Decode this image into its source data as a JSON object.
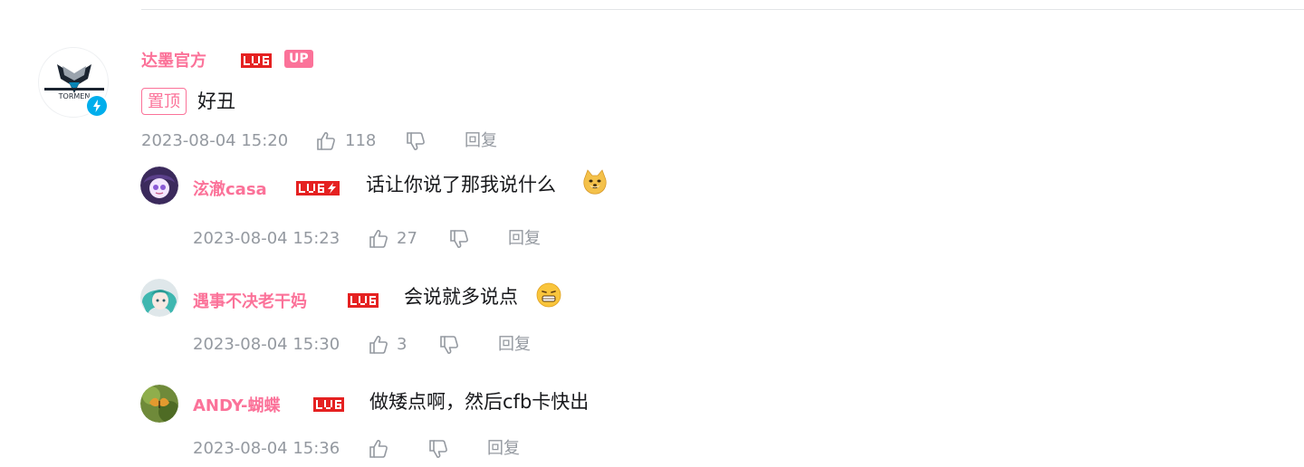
{
  "root": {
    "username": "达墨官方",
    "level": "LV6",
    "up_badge": "UP",
    "pin_label": "置顶",
    "content": "好丑",
    "time": "2023-08-04 15:20",
    "likes": "118",
    "reply_label": "回复"
  },
  "replies": [
    {
      "username": "泫澈casa",
      "level": "LV6",
      "content": "话让你说了那我说什么",
      "emoji": "doge-emoji",
      "time": "2023-08-04 15:23",
      "likes": "27",
      "reply_label": "回复"
    },
    {
      "username": "遇事不决老干妈",
      "level": "LV6",
      "content": "会说就多说点",
      "emoji": "grin-emoji",
      "time": "2023-08-04 15:30",
      "likes": "3",
      "reply_label": "回复"
    },
    {
      "username": "ANDY-蝴蝶",
      "level": "LV6",
      "content": "做矮点啊，然后cfb卡快出",
      "time": "2023-08-04 15:36",
      "likes": "",
      "reply_label": "回复"
    }
  ],
  "colors": {
    "username": "#fb7299",
    "level_red": "#e52121",
    "meta": "#9499a0",
    "verify_blue": "#00aeec"
  }
}
